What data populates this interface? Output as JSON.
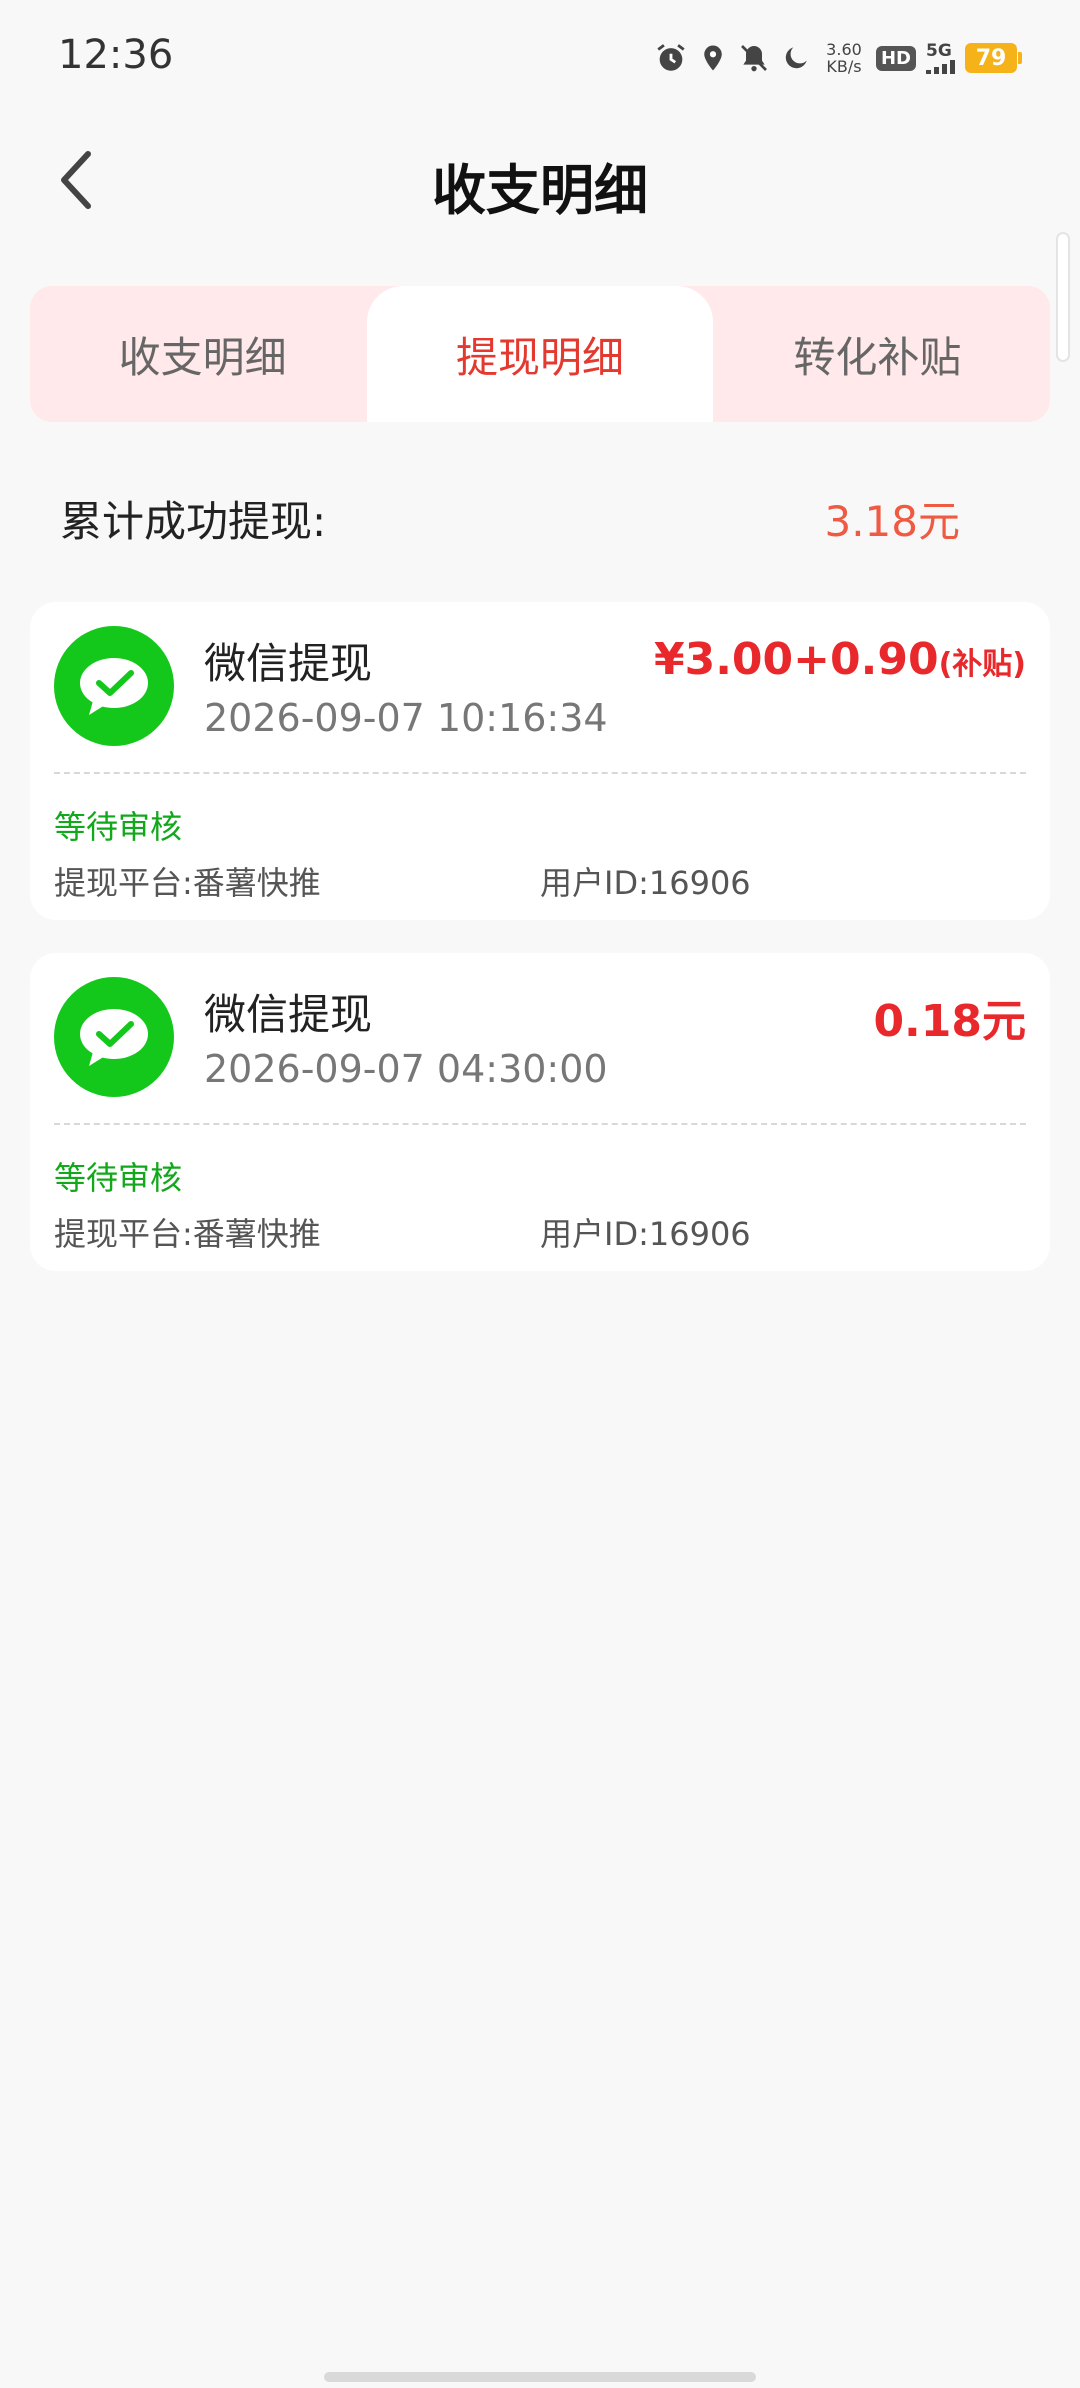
{
  "status_bar": {
    "time": "12:36",
    "net_speed_value": "3.60",
    "net_speed_unit": "KB/s",
    "hd_label": "HD",
    "signal_label": "5G",
    "battery": "79"
  },
  "header": {
    "title": "收支明细"
  },
  "tabs": [
    {
      "label": "收支明细",
      "active": false
    },
    {
      "label": "提现明细",
      "active": true
    },
    {
      "label": "转化补贴",
      "active": false
    }
  ],
  "summary": {
    "label": "累计成功提现:",
    "value": "3.18元"
  },
  "records": [
    {
      "title": "微信提现",
      "time": "2026-09-07 10:16:34",
      "amount": "¥3.00+0.90",
      "amount_suffix": "(补贴)",
      "status": "等待审核",
      "platform": "提现平台:番薯快推",
      "user_id": "用户ID:16906"
    },
    {
      "title": "微信提现",
      "time": "2026-09-07 04:30:00",
      "amount": "0.18元",
      "amount_suffix": "",
      "status": "等待审核",
      "platform": "提现平台:番薯快推",
      "user_id": "用户ID:16906"
    }
  ],
  "colors": {
    "accent_red": "#e4392f",
    "amount_red": "#e8282b",
    "wechat_green": "#13c81b",
    "status_green": "#12a81b",
    "tab_bg": "#ffe9ea"
  },
  "icons": {
    "back": "chevron-left-icon",
    "record": "wechat-icon"
  }
}
